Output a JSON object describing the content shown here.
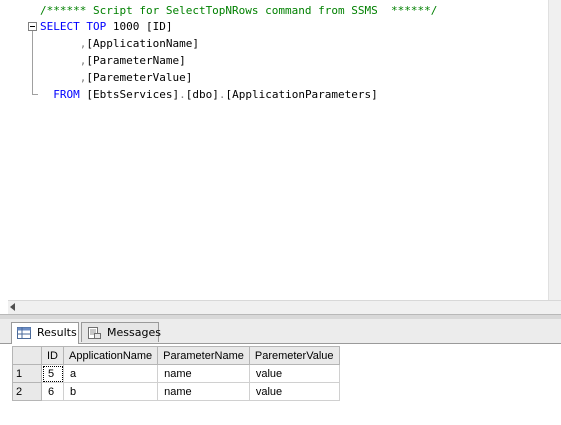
{
  "editor": {
    "lines": [
      [
        {
          "t": "/****** Script for SelectTopNRows command from SSMS  ******/",
          "c": "comment"
        }
      ],
      [
        {
          "t": "SELECT",
          "c": "kw"
        },
        {
          "t": " ",
          "c": "ident"
        },
        {
          "t": "TOP",
          "c": "kw"
        },
        {
          "t": " 1000 [ID]",
          "c": "ident"
        }
      ],
      [
        {
          "t": "      ",
          "c": "ident"
        },
        {
          "t": ",",
          "c": "gray"
        },
        {
          "t": "[ApplicationName]",
          "c": "ident"
        }
      ],
      [
        {
          "t": "      ",
          "c": "ident"
        },
        {
          "t": ",",
          "c": "gray"
        },
        {
          "t": "[ParameterName]",
          "c": "ident"
        }
      ],
      [
        {
          "t": "      ",
          "c": "ident"
        },
        {
          "t": ",",
          "c": "gray"
        },
        {
          "t": "[ParemeterValue]",
          "c": "ident"
        }
      ],
      [
        {
          "t": "  ",
          "c": "ident"
        },
        {
          "t": "FROM",
          "c": "kw"
        },
        {
          "t": " [EbtsServices]",
          "c": "ident"
        },
        {
          "t": ".",
          "c": "gray"
        },
        {
          "t": "[dbo]",
          "c": "ident"
        },
        {
          "t": ".",
          "c": "gray"
        },
        {
          "t": "[ApplicationParameters]",
          "c": "ident"
        }
      ]
    ]
  },
  "tabs": {
    "results_label": "Results",
    "messages_label": "Messages"
  },
  "grid": {
    "columns": [
      "ID",
      "ApplicationName",
      "ParameterName",
      "ParemeterValue"
    ],
    "rows": [
      {
        "num": "1",
        "cells": [
          "5",
          "a",
          "name",
          "value"
        ]
      },
      {
        "num": "2",
        "cells": [
          "6",
          "b",
          "name",
          "value"
        ]
      }
    ]
  },
  "colors": {
    "keyword": "#0000ff",
    "comment": "#008000",
    "operator": "#808080"
  },
  "icons": {
    "results_tab": "grid-icon",
    "messages_tab": "messages-icon",
    "scroll_left": "scroll-left-arrow-icon"
  }
}
